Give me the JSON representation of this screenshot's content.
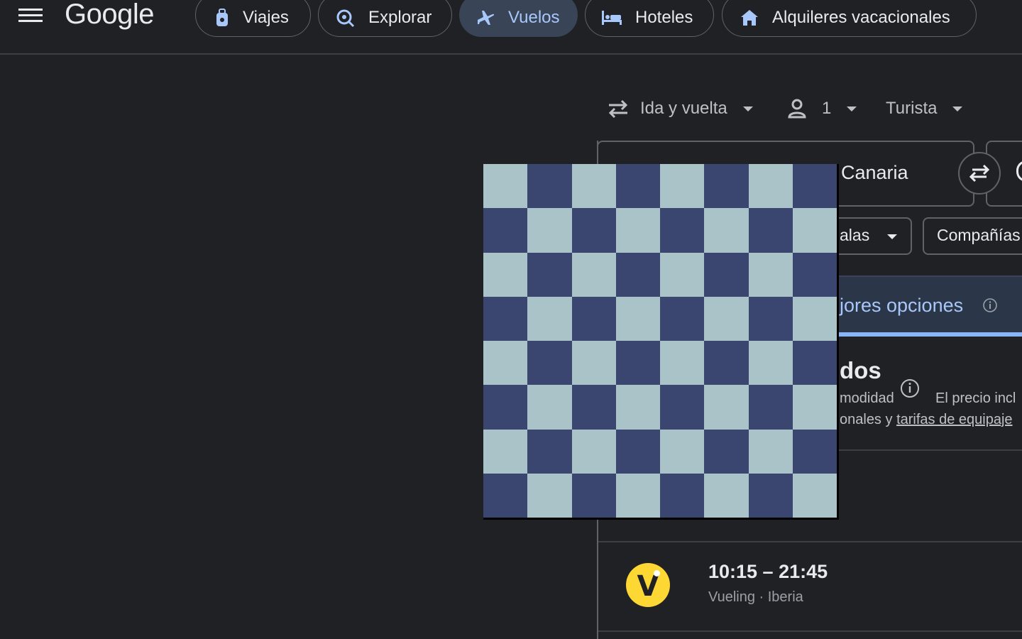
{
  "header": {
    "logo_text": "Google",
    "nav": [
      {
        "label": "Viajes",
        "icon": "luggage-icon"
      },
      {
        "label": "Explorar",
        "icon": "explore-icon"
      },
      {
        "label": "Vuelos",
        "icon": "flight-icon",
        "active": true
      },
      {
        "label": "Hoteles",
        "icon": "hotel-icon"
      },
      {
        "label": "Alquileres vacacionales",
        "icon": "house-icon"
      }
    ]
  },
  "search": {
    "trip_type": "Ida y vuelta",
    "passengers": "1",
    "cabin_class": "Turista",
    "origin": "Canaria",
    "filters": {
      "stops": "alas",
      "airlines": "Compañías"
    }
  },
  "tabs": {
    "best_label": "jores opciones"
  },
  "results": {
    "title": "dos",
    "sub1": "modidad",
    "price_note": "El precio incl",
    "sub2_prefix": "onales y ",
    "sub2_link": "tarifas de equipaje"
  },
  "flight": {
    "logo_letter": "V",
    "times": "10:15 – 21:45",
    "carriers": "Vueling · Iberia"
  },
  "colors": {
    "background": "#202124",
    "accent": "#8ab4f8",
    "checker_light": "#a9c3c8",
    "checker_dark": "#3a4570",
    "vueling_yellow": "#fdd835"
  }
}
